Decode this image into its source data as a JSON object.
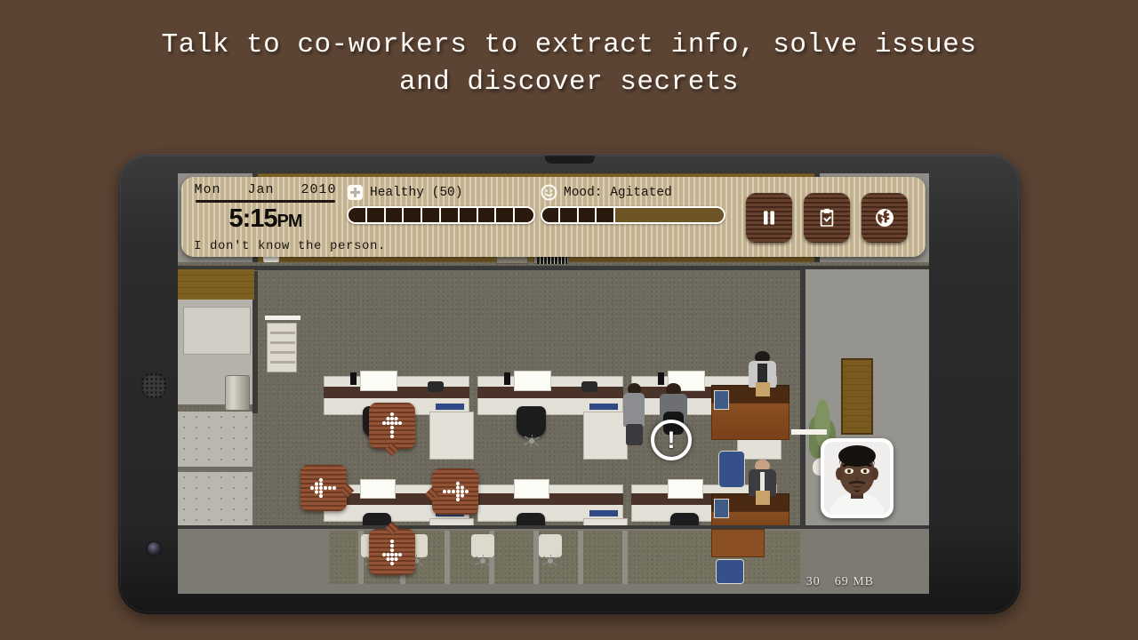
{
  "promo": {
    "headline": "Talk to co-workers to extract info, solve issues\nand discover secrets",
    "background_color": "#5c4434",
    "text_color": "#fdfaf6"
  },
  "device": {
    "type": "tablet",
    "bezel_color": "#2c2c2c",
    "speaker": "speaker-grille",
    "front_camera": "front-camera-lens"
  },
  "hud": {
    "date": "Mon   Jan   2010",
    "time": "5:15",
    "time_period": "PM",
    "subtitle": "I don't know the person.",
    "health": {
      "icon": "health-cross-icon",
      "label": "Healthy (50)",
      "filled_segments": 10,
      "total_segments": 10,
      "fill_color": "#2a1a0e"
    },
    "mood": {
      "icon": "smiley-face-icon",
      "label": "Mood: Agitated",
      "filled_segments": 4,
      "total_segments": 10,
      "fill_color": "#2a1a0e",
      "empty_color": "#6d5526"
    },
    "buttons": [
      {
        "name": "pause-button",
        "icon": "pause-icon",
        "label": "Pause"
      },
      {
        "name": "tasks-button",
        "icon": "clipboard-check-icon",
        "label": "Tasks"
      },
      {
        "name": "map-button",
        "icon": "globe-icon",
        "label": "Map"
      }
    ],
    "panel_color": "#cdbd9c",
    "button_color": "#5d3520"
  },
  "world": {
    "nav_buttons": [
      {
        "name": "nav-up-button",
        "direction": "up"
      },
      {
        "name": "nav-left-button",
        "direction": "left"
      },
      {
        "name": "nav-right-button",
        "direction": "right"
      },
      {
        "name": "nav-down-button",
        "direction": "down"
      }
    ],
    "player_marker": {
      "name": "player-marker",
      "glyph": "!"
    },
    "portrait": {
      "name": "character-portrait",
      "character": "co-worker"
    }
  },
  "debug": {
    "fps": "30",
    "memory": "69 MB"
  }
}
